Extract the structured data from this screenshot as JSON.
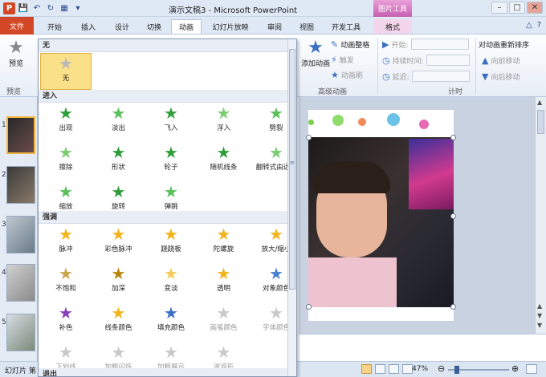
{
  "window": {
    "title": "演示文稿3 - Microsoft PowerPoint",
    "context_group": "图片工具",
    "app_icon": "P"
  },
  "tabs": [
    {
      "label": "文件"
    },
    {
      "label": "开始"
    },
    {
      "label": "插入"
    },
    {
      "label": "设计"
    },
    {
      "label": "切换"
    },
    {
      "label": "动画"
    },
    {
      "label": "幻灯片放映"
    },
    {
      "label": "审阅"
    },
    {
      "label": "视图"
    },
    {
      "label": "开发工具"
    },
    {
      "label": "格式"
    }
  ],
  "ribbon": {
    "preview_label": "预览",
    "preview_group": "预览",
    "add_animation": "添加动画",
    "animation_painter": "动画整格",
    "trigger": "触发",
    "animation_pane": "动画刷",
    "advanced_group": "高级动画",
    "start_label": "开始:",
    "duration_label": "持续时间:",
    "delay_label": "延迟:",
    "timing_group": "计时",
    "reorder_title": "对动画重新排序",
    "move_earlier": "向前移动",
    "move_later": "向后移动"
  },
  "gallery": {
    "sections": {
      "none": "无",
      "entrance": "进入",
      "emphasis": "强调",
      "exit": "退出"
    },
    "none_item": "无",
    "entrance": [
      {
        "label": "出现",
        "color": "#2f9e3a"
      },
      {
        "label": "淡出",
        "color": "#5cc05a"
      },
      {
        "label": "飞入",
        "color": "#2f9e3a"
      },
      {
        "label": "浮入",
        "color": "#7ccd72"
      },
      {
        "label": "劈裂",
        "color": "#5cc05a"
      },
      {
        "label": "擦除",
        "color": "#7ccd72"
      },
      {
        "label": "形状",
        "color": "#2f9e3a"
      },
      {
        "label": "轮子",
        "color": "#2f9e3a"
      },
      {
        "label": "随机线条",
        "color": "#2f9e3a"
      },
      {
        "label": "翻转式由远...",
        "color": "#7ccd72"
      },
      {
        "label": "缩放",
        "color": "#5cc05a"
      },
      {
        "label": "旋转",
        "color": "#2f9e3a"
      },
      {
        "label": "弹跳",
        "color": "#5cc05a"
      }
    ],
    "emphasis": [
      {
        "label": "脉冲",
        "color": "#f2b31b",
        "disabled": false
      },
      {
        "label": "彩色脉冲",
        "color": "#f2b31b",
        "disabled": false
      },
      {
        "label": "跷跷板",
        "color": "#f2b31b",
        "disabled": false
      },
      {
        "label": "陀螺旋",
        "color": "#f2b31b",
        "disabled": false
      },
      {
        "label": "放大/缩小",
        "color": "#f2b31b",
        "disabled": false
      },
      {
        "label": "不饱和",
        "color": "#c9a54a",
        "disabled": false
      },
      {
        "label": "加深",
        "color": "#b8860b",
        "disabled": false
      },
      {
        "label": "变淡",
        "color": "#f5cc5a",
        "disabled": false
      },
      {
        "label": "透明",
        "color": "#f2b31b",
        "disabled": false
      },
      {
        "label": "对象颜色",
        "color": "#4a7fd0",
        "disabled": false
      },
      {
        "label": "补色",
        "color": "#8a3fb5",
        "disabled": false
      },
      {
        "label": "线条颜色",
        "color": "#f2b31b",
        "disabled": false
      },
      {
        "label": "填充颜色",
        "color": "#3a6fc2",
        "disabled": false
      },
      {
        "label": "画笔颜色",
        "color": "#c8c8c8",
        "disabled": true
      },
      {
        "label": "字体颜色",
        "color": "#c8c8c8",
        "disabled": true
      },
      {
        "label": "下划线",
        "color": "#c8c8c8",
        "disabled": true
      },
      {
        "label": "加粗闪烁",
        "color": "#c8c8c8",
        "disabled": true
      },
      {
        "label": "加粗展示",
        "color": "#c8c8c8",
        "disabled": true
      },
      {
        "label": "波浪形",
        "color": "#c8c8c8",
        "disabled": true
      }
    ]
  },
  "slides": [
    "1",
    "2",
    "3",
    "4",
    "5"
  ],
  "status": {
    "left": "幻灯片 第",
    "zoom": "47%"
  }
}
